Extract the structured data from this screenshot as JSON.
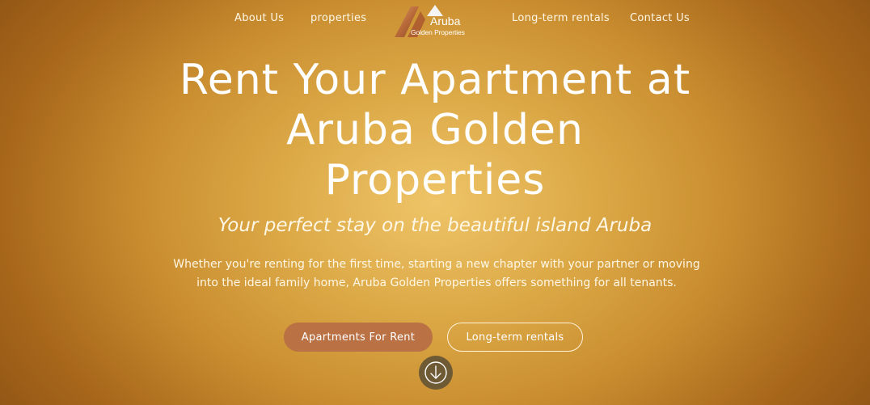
{
  "nav": {
    "items_left": [
      {
        "label": "About Us"
      },
      {
        "label": "properties"
      }
    ],
    "items_right": [
      {
        "label": "Long-term rentals"
      },
      {
        "label": "Contact Us"
      }
    ],
    "logo": {
      "title": "Aruba",
      "subtitle": "Golden Properties"
    }
  },
  "hero": {
    "title_lines": [
      "Rent Your Apartment at",
      "Aruba Golden",
      "Properties"
    ],
    "subtitle": "Your perfect stay on the beautiful island Aruba",
    "description": "Whether you're renting for the first time, starting a new chapter with your partner or moving into the ideal family home, Aruba Golden Properties offers something for all tenants.",
    "buttons": {
      "primary_label": "Apartments For Rent",
      "secondary_label": "Long-term rentals"
    },
    "scroll_icon": "arrow-down-circle-icon"
  },
  "colors": {
    "background_center": "#eec468",
    "background_edge": "#8f5414",
    "primary_button": "#ba7144",
    "scroll_button": "#6e5a35",
    "text": "#ffffff"
  }
}
